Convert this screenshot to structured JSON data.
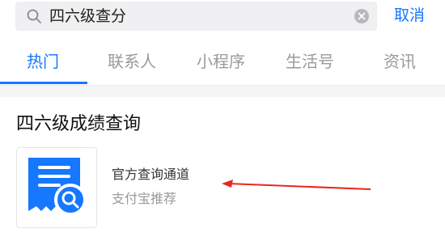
{
  "search": {
    "query": "四六级查分",
    "icon": "search-icon",
    "clear_icon": "clear-icon",
    "cancel_label": "取消"
  },
  "tabs": [
    {
      "label": "热门",
      "active": true
    },
    {
      "label": "联系人",
      "active": false
    },
    {
      "label": "小程序",
      "active": false
    },
    {
      "label": "生活号",
      "active": false
    },
    {
      "label": "资讯",
      "active": false
    }
  ],
  "result_section": {
    "title": "四六级成绩查询",
    "item": {
      "icon": "certificate-search-icon",
      "title": "官方查询通道",
      "subtitle": "支付宝推荐"
    }
  },
  "annotation": {
    "icon": "red-arrow-icon",
    "color": "#e8281e"
  },
  "colors": {
    "accent": "#1677ff",
    "tab_inactive": "#9a9a9a",
    "search_bg": "#f0f0f2"
  }
}
